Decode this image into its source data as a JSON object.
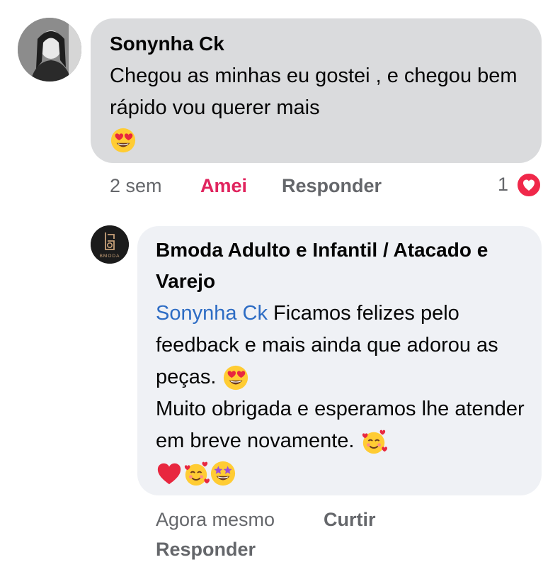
{
  "comment": {
    "author": "Sonynha Ck",
    "text": "Chegou as minhas eu gostei , e chegou bem rápido vou querer mais",
    "emoji": "heart-eyes-emoji",
    "time": "2 sem",
    "like_label": "Amei",
    "reply_label": "Responder",
    "reaction_count": "1",
    "reaction_icon": "heart-reaction-icon",
    "like_color": "#e0245e"
  },
  "reply": {
    "author": "Bmoda Adulto e Infantil / Atacado e Varejo",
    "avatar_logo_text": "BMODA",
    "mention": "Sonynha Ck",
    "text_part1": " Ficamos felizes pelo feedback e mais ainda que adorou as peças.",
    "text_part2": "Muito obrigada e esperamos lhe atender em breve novamente.",
    "time": "Agora mesmo",
    "like_label": "Curtir",
    "reply_label": "Responder",
    "mention_color": "#2d6cc4"
  },
  "colors": {
    "bubble_main": "#dadbdd",
    "bubble_reply": "#eff1f5",
    "meta_text": "#65676b"
  }
}
